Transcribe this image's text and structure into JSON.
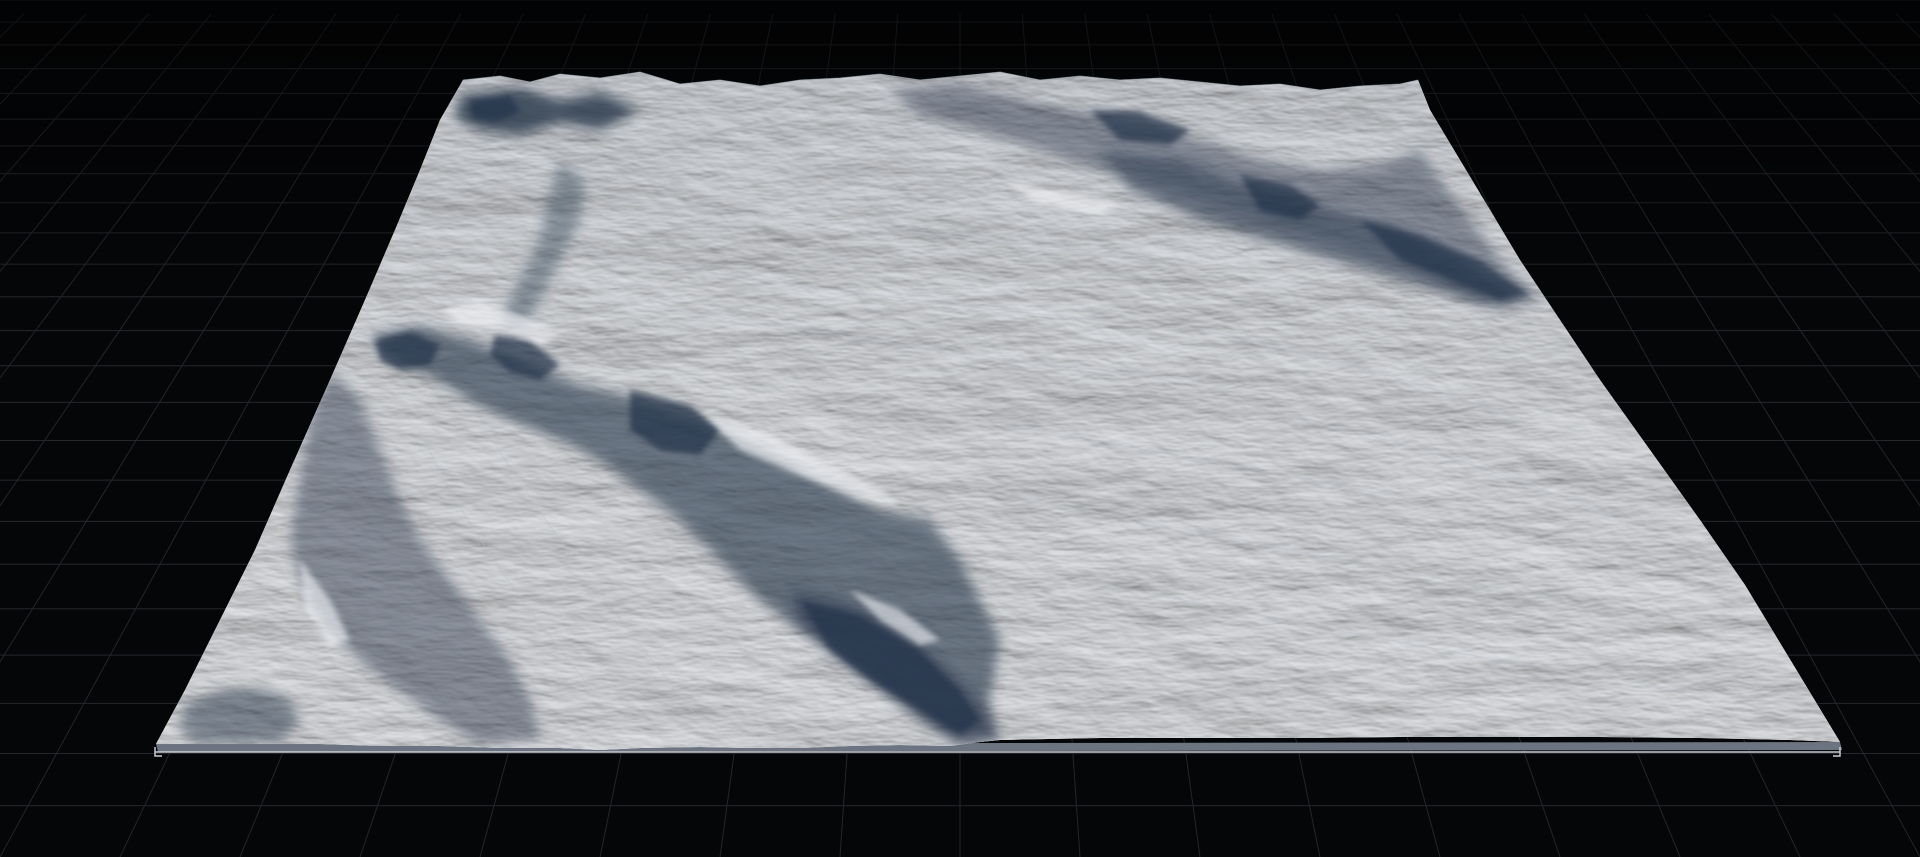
{
  "viewport": {
    "background_color": "#050608",
    "grid_color": "#23262b",
    "grid_visible": true
  },
  "terrain": {
    "surface_color": "#d9dde3",
    "shadow_color": "#2c3a4d",
    "highlight_color": "#f2f4f7"
  },
  "bounds_marker": {
    "color": "#c9ccd1",
    "visible": true
  }
}
